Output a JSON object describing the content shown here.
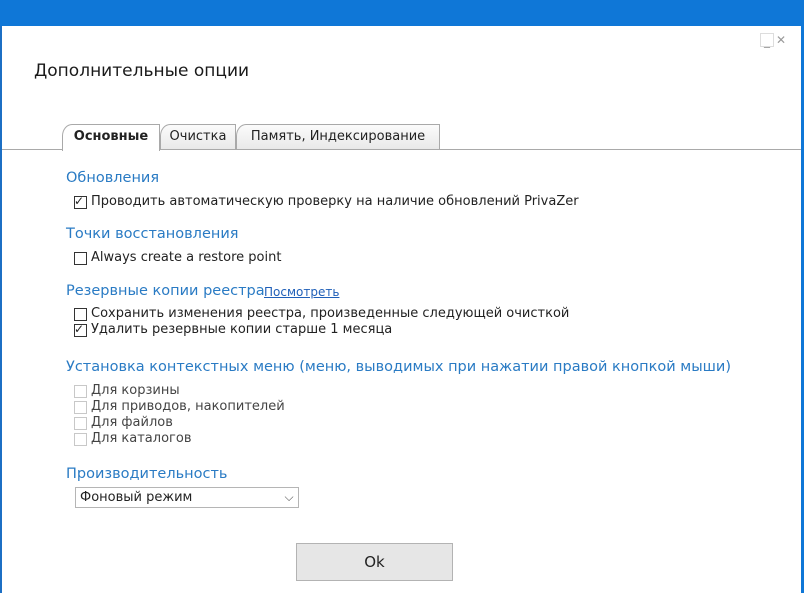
{
  "window": {
    "title": "Дополнительные опции",
    "minimize_glyph": "_",
    "close_glyph": "✕"
  },
  "tabs": [
    {
      "label": "Основные",
      "active": true
    },
    {
      "label": "Очистка",
      "active": false
    },
    {
      "label": "Память, Индексирование",
      "active": false
    }
  ],
  "sections": {
    "updates": {
      "title": "Обновления",
      "items": [
        {
          "label": "Проводить автоматическую проверку на наличие обновлений PrivaZer",
          "checked": true
        }
      ]
    },
    "restore": {
      "title": "Точки восстановления",
      "items": [
        {
          "label": "Always create a restore point",
          "checked": false
        }
      ]
    },
    "registry": {
      "title": "Резервные копии реестра",
      "link": "Посмотреть",
      "items": [
        {
          "label": "Сохранить изменения реестра, произведенные следующей очисткой",
          "checked": false
        },
        {
          "label": "Удалить резервные копии старше 1 месяца",
          "checked": true
        }
      ]
    },
    "context_menu": {
      "title": "Установка контекстных меню (меню, выводимых при нажатии правой кнопкой мыши)",
      "items": [
        {
          "label": "Для корзины",
          "checked": false,
          "disabled": true
        },
        {
          "label": "Для приводов, накопителей",
          "checked": false,
          "disabled": true
        },
        {
          "label": "Для файлов",
          "checked": false,
          "disabled": true
        },
        {
          "label": "Для каталогов",
          "checked": false,
          "disabled": true
        }
      ]
    },
    "performance": {
      "title": "Производительность",
      "select_value": "Фоновый режим"
    }
  },
  "buttons": {
    "ok": "Ok"
  },
  "colors": {
    "title_bar": "#0f77d7",
    "section_title": "#2a7bc4",
    "link": "#1f5fb8"
  }
}
